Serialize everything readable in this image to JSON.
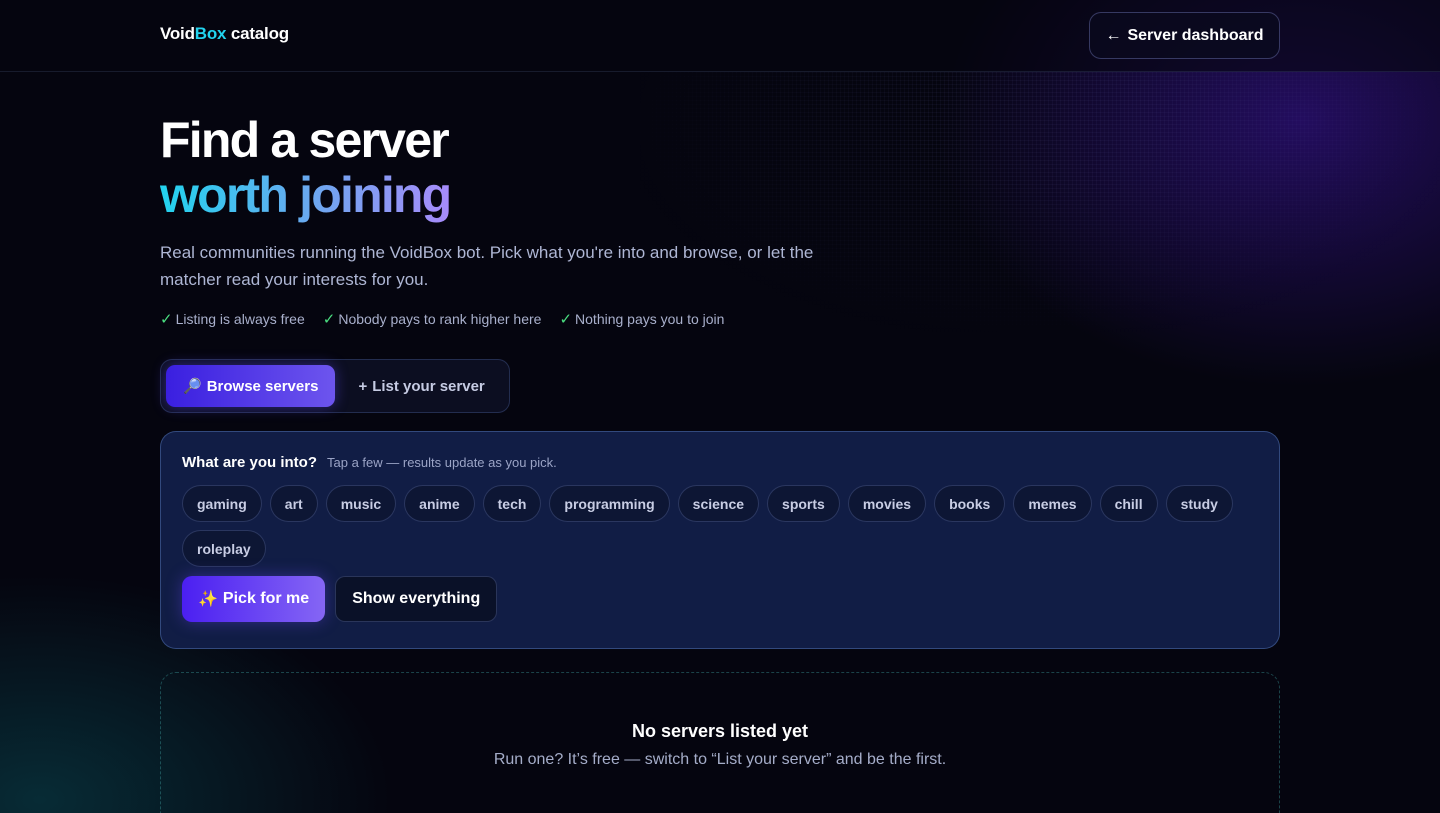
{
  "header": {
    "logo_part1": "Void",
    "logo_part2": "Box",
    "logo_part3": " catalog",
    "dashboard_arrow": "←",
    "dashboard_label": "Server dashboard"
  },
  "hero": {
    "title_line1": "Find a server",
    "title_line2": "worth joining",
    "subtitle": "Real communities running the VoidBox bot. Pick what you're into and browse, or let the matcher read your interests for you.",
    "checks": [
      {
        "icon": "✓",
        "label": "Listing is always free"
      },
      {
        "icon": "✓",
        "label": "Nobody pays to rank higher here"
      },
      {
        "icon": "✓",
        "label": "Nothing pays you to join"
      }
    ]
  },
  "tabs": [
    {
      "icon": "🔎",
      "label": "Browse servers",
      "active": true
    },
    {
      "icon": "+",
      "label": "List your server",
      "active": false
    }
  ],
  "interests": {
    "title": "What are you into?",
    "hint": "Tap a few — results update as you pick.",
    "tags": [
      "gaming",
      "art",
      "music",
      "anime",
      "tech",
      "programming",
      "science",
      "sports",
      "movies",
      "books",
      "memes",
      "chill",
      "study",
      "roleplay"
    ],
    "pick_icon": "✨",
    "pick_label": "Pick for me",
    "show_all_label": "Show everything"
  },
  "empty_state": {
    "title": "No servers listed yet",
    "text": "Run one? It’s free — switch to “List your server” and be the first."
  },
  "colors": {
    "accent_cyan": "#22d3ee",
    "accent_purple": "#a78bfa",
    "primary_button": "#4b1ff2",
    "check_green": "#4ade80",
    "panel_bg": "#111d45"
  }
}
